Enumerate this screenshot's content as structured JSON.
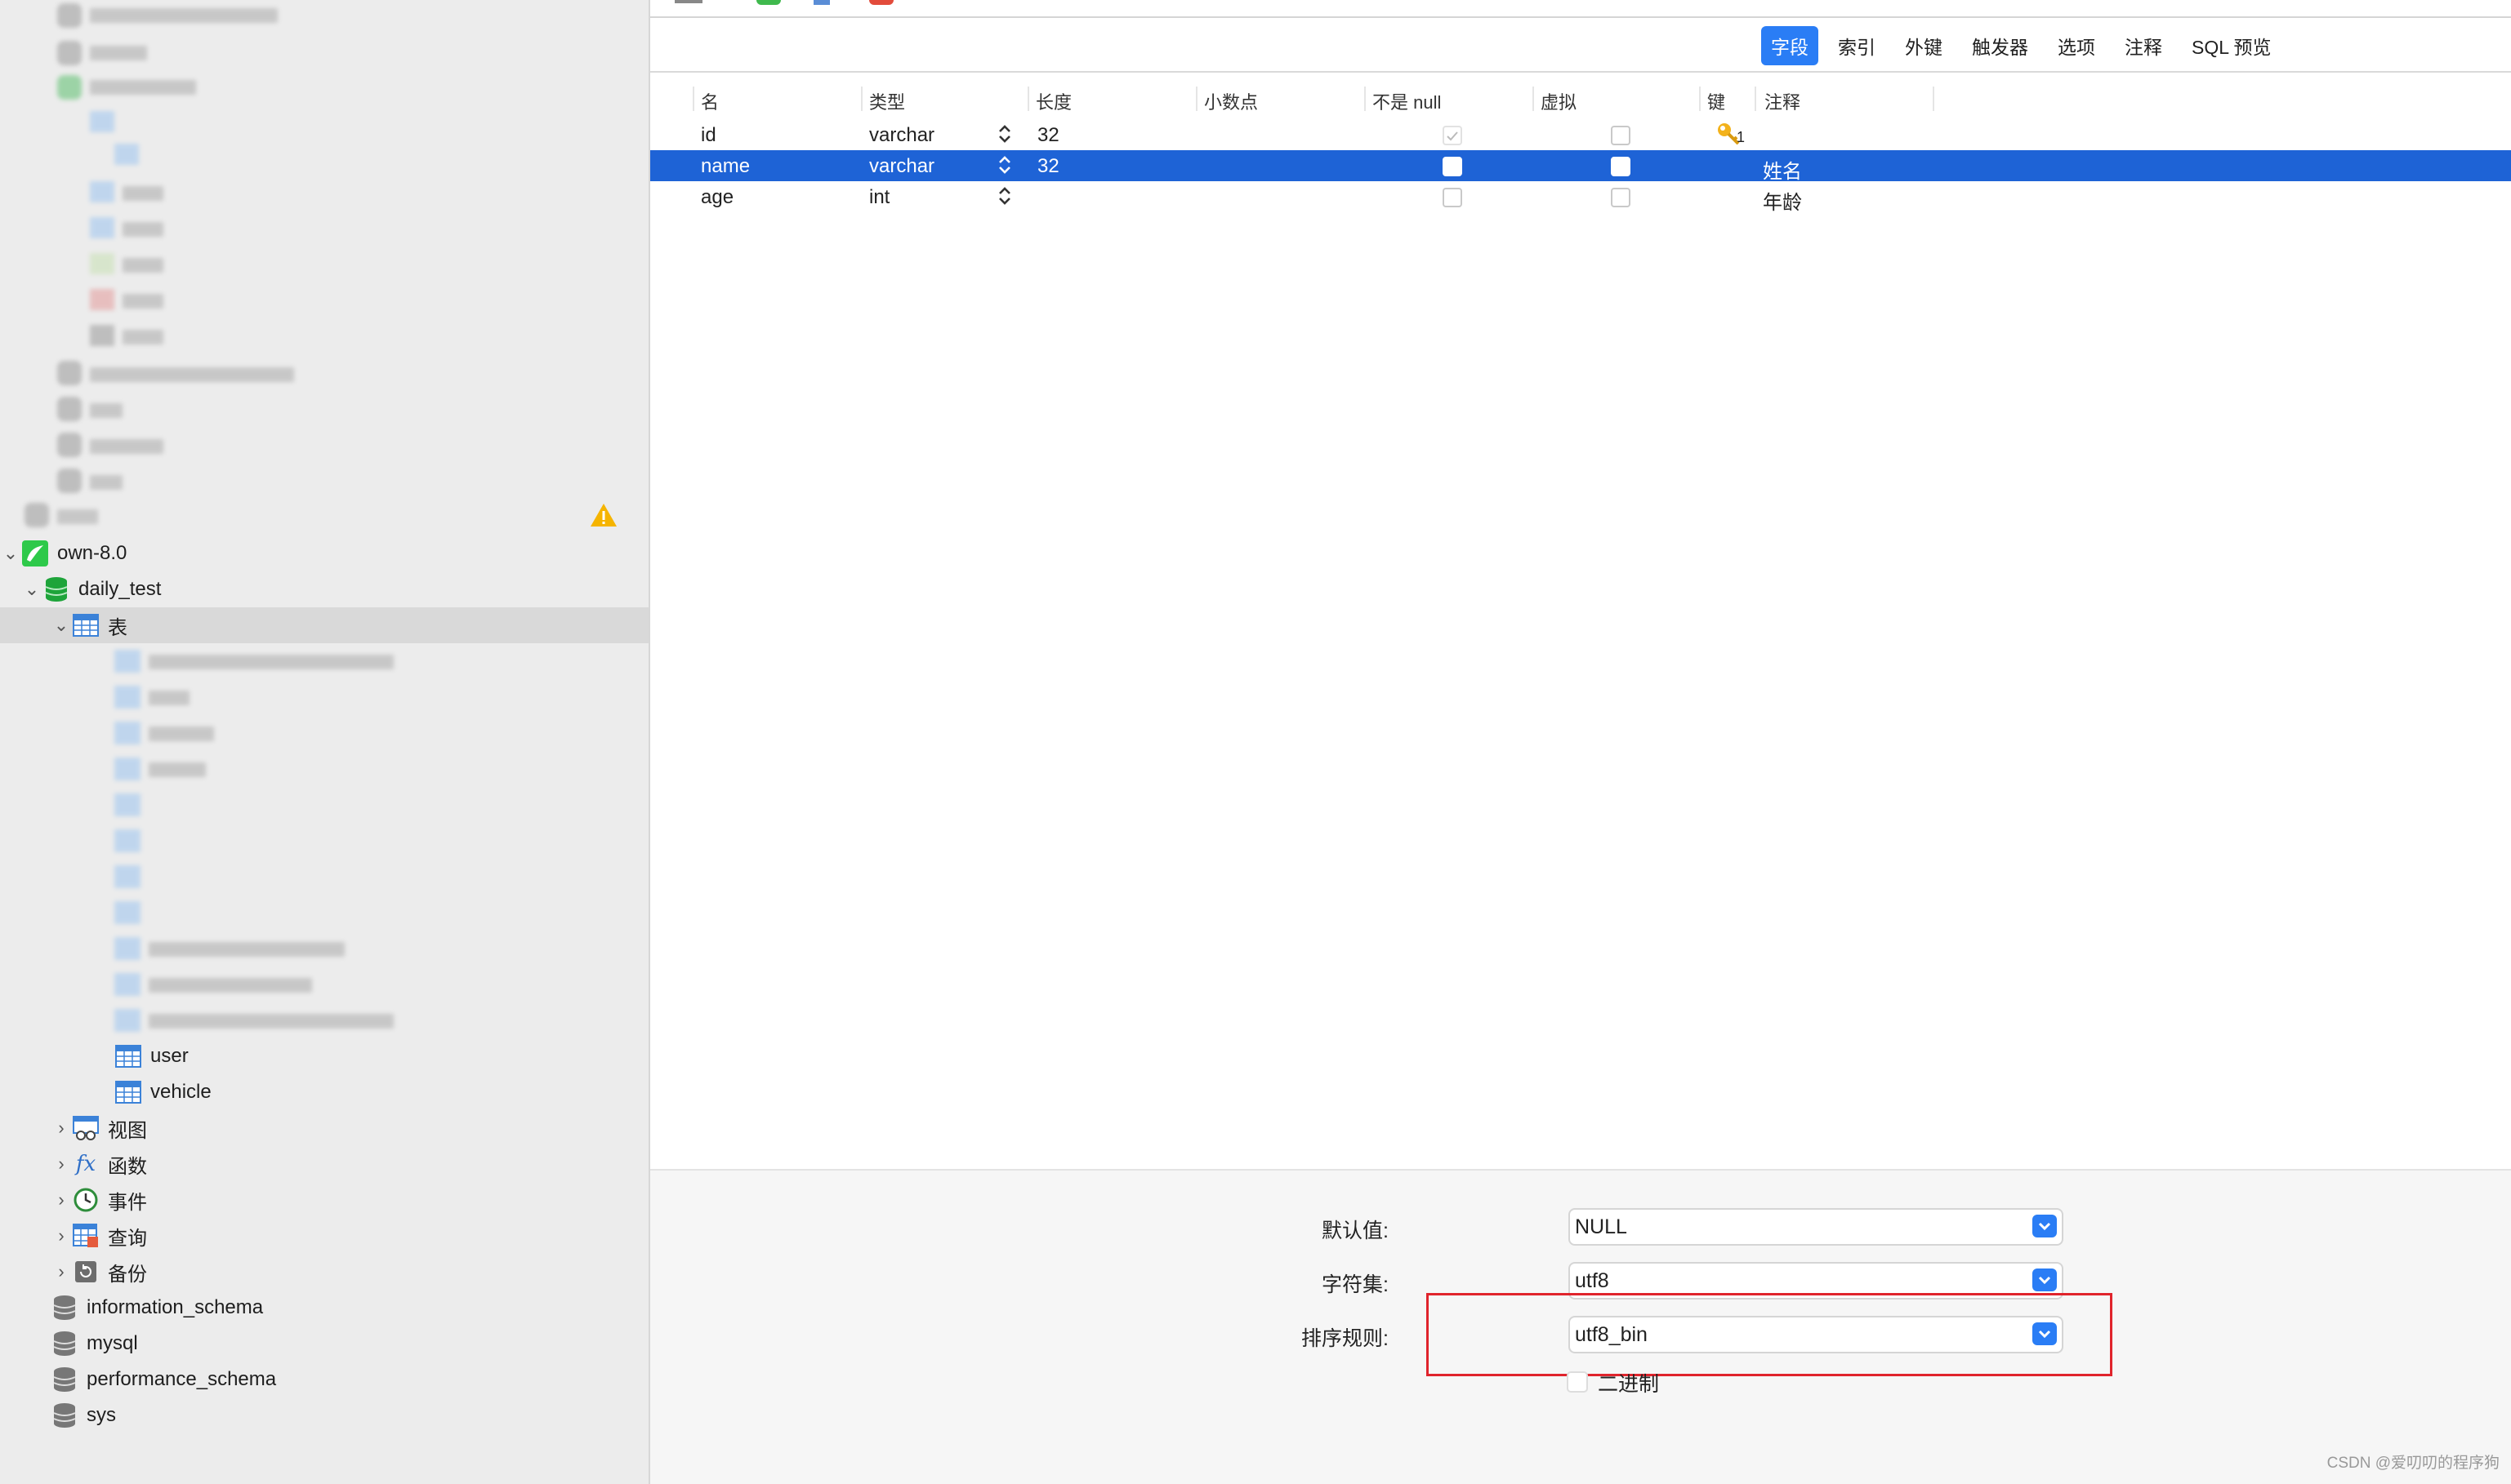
{
  "sidebar": {
    "connection": "own-8.0",
    "database": "daily_test",
    "tables_label": "表",
    "tables": [
      "user",
      "vehicle"
    ],
    "views_label": "视图",
    "functions_label": "函数",
    "events_label": "事件",
    "queries_label": "查询",
    "backups_label": "备份",
    "other_dbs": [
      "information_schema",
      "mysql",
      "performance_schema",
      "sys"
    ]
  },
  "tabs": [
    "字段",
    "索引",
    "外键",
    "触发器",
    "选项",
    "注释",
    "SQL 预览"
  ],
  "grid": {
    "headers": [
      "名",
      "类型",
      "长度",
      "小数点",
      "不是 null",
      "虚拟",
      "键",
      "注释"
    ],
    "rows": [
      {
        "name": "id",
        "type": "varchar",
        "length": "32",
        "decimal": "",
        "not_null": true,
        "virtual": false,
        "key": "1",
        "comment": ""
      },
      {
        "name": "name",
        "type": "varchar",
        "length": "32",
        "decimal": "",
        "not_null": false,
        "virtual": false,
        "key": "",
        "comment": "姓名"
      },
      {
        "name": "age",
        "type": "int",
        "length": "",
        "decimal": "",
        "not_null": false,
        "virtual": false,
        "key": "",
        "comment": "年龄"
      }
    ]
  },
  "props": {
    "default_label": "默认值:",
    "default_value": "NULL",
    "charset_label": "字符集:",
    "charset_value": "utf8",
    "collation_label": "排序规则:",
    "collation_value": "utf8_bin",
    "binary_label": "二进制"
  },
  "watermark": "CSDN @爱叨叨的程序狗",
  "colors": {
    "accent": "#2a7df5",
    "selection": "#1e63d6",
    "highlight_box": "#e0242c",
    "db_icon": "#1ea43a"
  }
}
